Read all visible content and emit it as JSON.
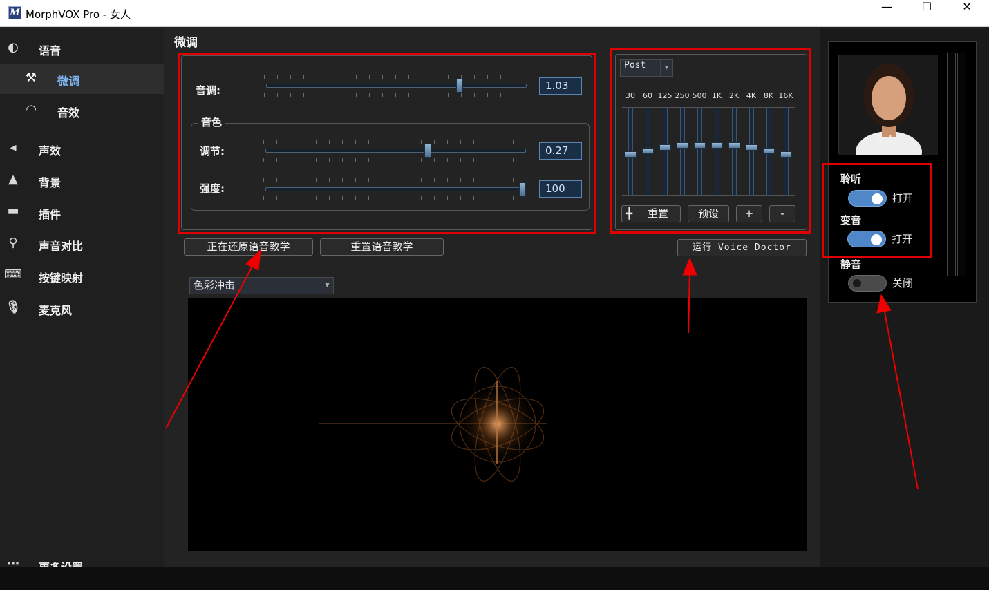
{
  "window": {
    "title": "MorphVOX Pro - 女人",
    "icon_letter": "M",
    "minimize": "—",
    "maximize": "☐",
    "close": "✕"
  },
  "sidebar": {
    "items": [
      {
        "label": "语音",
        "icon": "disc-icon",
        "glyph": "◐"
      },
      {
        "label": "微调",
        "icon": "tools-icon",
        "glyph": "⚒"
      },
      {
        "label": "音效",
        "icon": "lips-icon",
        "glyph": "◠"
      },
      {
        "label": "声效",
        "icon": "speaker-icon",
        "glyph": "◂"
      },
      {
        "label": "背景",
        "icon": "mountain-icon",
        "glyph": "▲"
      },
      {
        "label": "插件",
        "icon": "plug-icon",
        "glyph": "▬"
      },
      {
        "label": "声音对比",
        "icon": "magnifier-icon",
        "glyph": "⚲"
      },
      {
        "label": "按键映射",
        "icon": "keyboard-icon",
        "glyph": "⌨"
      },
      {
        "label": "麦克风",
        "icon": "microphone-icon",
        "glyph": "🎙"
      },
      {
        "label": "更多设置",
        "icon": "more-icon",
        "glyph": "⋯"
      }
    ]
  },
  "tweak": {
    "title": "微调",
    "pitch": {
      "label": "音调:",
      "value": "1.03",
      "level": 0.75
    },
    "timbre_group": "音色",
    "adjust": {
      "label": "调节:",
      "value": "0.27",
      "level": 0.63
    },
    "strength": {
      "label": "强度:",
      "value": "100",
      "level": 1.0
    },
    "restore_button": "正在还原语音教学",
    "reset_button": "重置语音教学"
  },
  "eq": {
    "mode": "Post",
    "bands": [
      "30",
      "60",
      "125",
      "250",
      "500",
      "1K",
      "2K",
      "4K",
      "8K",
      "16K"
    ],
    "levels": [
      0.47,
      0.51,
      0.55,
      0.57,
      0.57,
      0.57,
      0.57,
      0.55,
      0.51,
      0.47
    ],
    "reset_button": "重置",
    "preset_button": "预设",
    "plus_button": "+",
    "minus_button": "-",
    "voice_doctor_button": "运行 Voice Doctor"
  },
  "visualizer": {
    "style": "色彩冲击"
  },
  "right": {
    "avatar_name": "女人",
    "listen": {
      "label": "聆听",
      "state": "打开"
    },
    "morph": {
      "label": "变音",
      "state": "打开"
    },
    "mute": {
      "label": "静音",
      "state": "关闭"
    }
  },
  "colors": {
    "annotation": "#e00000",
    "accent": "#4f87c9"
  }
}
